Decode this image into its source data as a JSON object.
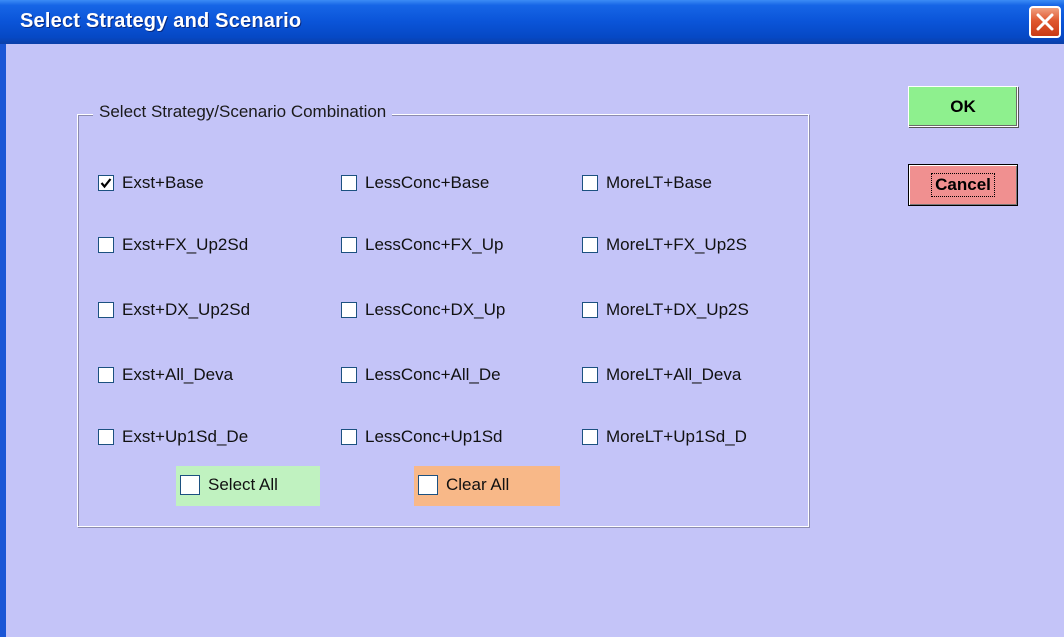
{
  "window": {
    "title": "Select Strategy and Scenario"
  },
  "group": {
    "label": "Select Strategy/Scenario Combination"
  },
  "options": [
    {
      "label": "Exst+Base",
      "checked": true
    },
    {
      "label": "LessConc+Base",
      "checked": false
    },
    {
      "label": "MoreLT+Base",
      "checked": false
    },
    {
      "label": "Exst+FX_Up2Sd",
      "checked": false
    },
    {
      "label": "LessConc+FX_Up",
      "checked": false
    },
    {
      "label": "MoreLT+FX_Up2S",
      "checked": false
    },
    {
      "label": "Exst+DX_Up2Sd",
      "checked": false
    },
    {
      "label": "LessConc+DX_Up",
      "checked": false
    },
    {
      "label": "MoreLT+DX_Up2S",
      "checked": false
    },
    {
      "label": "Exst+All_Deva",
      "checked": false
    },
    {
      "label": "LessConc+All_De",
      "checked": false
    },
    {
      "label": "MoreLT+All_Deva",
      "checked": false
    },
    {
      "label": "Exst+Up1Sd_De",
      "checked": false
    },
    {
      "label": "LessConc+Up1Sd",
      "checked": false
    },
    {
      "label": "MoreLT+Up1Sd_D",
      "checked": false
    }
  ],
  "select_all": {
    "label": "Select All",
    "checked": false
  },
  "clear_all": {
    "label": "Clear All",
    "checked": false
  },
  "buttons": {
    "ok": "OK",
    "cancel": "Cancel"
  },
  "colors": {
    "dialog_bg": "#c4c4f8",
    "title_bar": "#0a54d8",
    "ok_bg": "#8ef08e",
    "cancel_bg": "#f09090",
    "select_all_bg": "#c0f2c0",
    "clear_all_bg": "#f8b888"
  }
}
